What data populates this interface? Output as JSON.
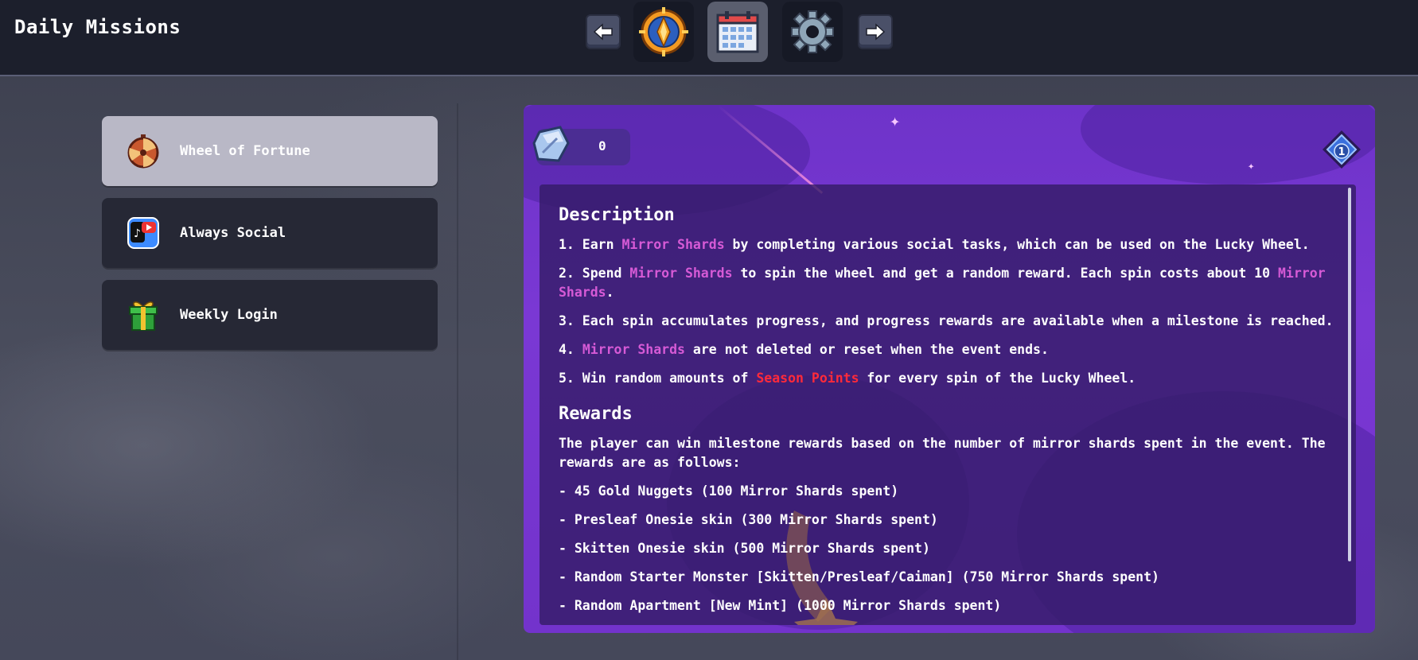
{
  "header": {
    "title": "Daily Missions",
    "nav": {
      "prev_icon": "arrow-left-icon",
      "next_icon": "arrow-right-icon",
      "tabs": [
        {
          "icon": "orange-compass-emblem-icon"
        },
        {
          "icon": "calendar-icon"
        },
        {
          "icon": "gear-icon"
        }
      ]
    }
  },
  "sidebar": {
    "items": [
      {
        "label": "Wheel of Fortune",
        "icon": "fortune-wheel-icon"
      },
      {
        "label": "Always Social",
        "icon": "social-app-icon"
      },
      {
        "label": "Weekly Login",
        "icon": "gift-box-icon"
      }
    ]
  },
  "panel": {
    "shard_count": "0",
    "shard_icon": "mirror-shard-icon",
    "badge_number": "1",
    "description_heading": "Description",
    "desc": {
      "l1_a": "1. Earn ",
      "l1_hl": "Mirror Shards",
      "l1_b": " by completing various social tasks, which can be used on the Lucky Wheel.",
      "l2_a": "2. Spend ",
      "l2_hl": "Mirror Shards",
      "l2_b": " to spin the wheel and get a random reward. Each spin costs about 10 ",
      "l2_hl2": "Mirror Shards",
      "l2_c": ".",
      "l3": "3. Each spin accumulates progress, and progress rewards are available when a milestone is reached.",
      "l4_a": "4. ",
      "l4_hl": "Mirror Shards",
      "l4_b": " are not deleted or reset when the event ends.",
      "l5_a": "5. Win random amounts of ",
      "l5_hl": "Season Points",
      "l5_b": " for every spin of the Lucky Wheel."
    },
    "rewards_heading": "Rewards",
    "rewards_intro": "The player can win milestone rewards based on the number of mirror shards spent in the event. The rewards are as follows:",
    "rewards": [
      "- 45 Gold Nuggets (100 Mirror Shards spent)",
      "- Presleaf Onesie skin (300 Mirror Shards spent)",
      "- Skitten Onesie skin (500 Mirror Shards spent)",
      "- Random Starter Monster [Skitten/Presleaf/Caiman] (750 Mirror Shards spent)",
      "- Random Apartment [New Mint] (1000 Mirror Shards spent)"
    ]
  },
  "colors": {
    "highlight_pink": "#d65ad6",
    "highlight_red": "#ff2a3a",
    "panel_purple": "#7333cc"
  }
}
